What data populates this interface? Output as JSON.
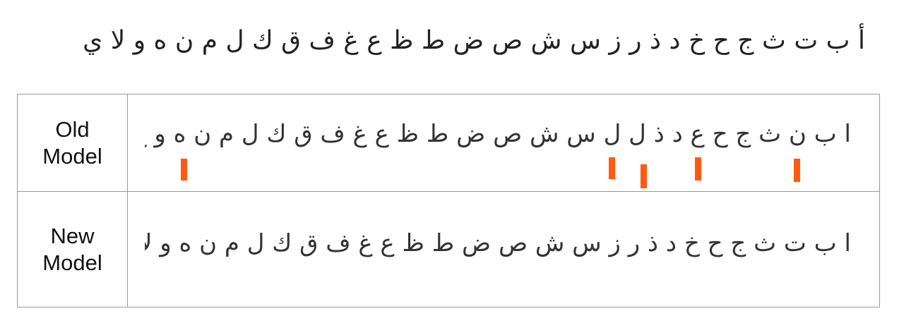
{
  "reference": {
    "alphabet": "أ ب ت ث ج ح خ د ذ ر ز س ش ص ض ط ظ ع غ ف ق ك ل م ن ه و لا ي"
  },
  "table": {
    "rows": [
      {
        "label_line1": "Old",
        "label_line2": "Model",
        "text": "ا ب ن ث ج ح ع د ذ ل ل س ش ص ض ط ظ ع غ ف ق ك ل م ن ه و خ ي",
        "error_marks": [
          {
            "color": "#ff5a12"
          },
          {
            "color": "#ff5a12"
          },
          {
            "color": "#ff5a12"
          },
          {
            "color": "#ff5a12"
          },
          {
            "color": "#ff5a12"
          }
        ]
      },
      {
        "label_line1": "New",
        "label_line2": "Model",
        "text": "ا ب ت ث ج ح خ د ذ ر ز س ش ص ض ط ظ ع غ ف ق ك ل م ن ه و لا ي"
      }
    ]
  },
  "colors": {
    "error_marker": "#ff5a12",
    "border": "#9a9a9a",
    "text": "#222222"
  }
}
